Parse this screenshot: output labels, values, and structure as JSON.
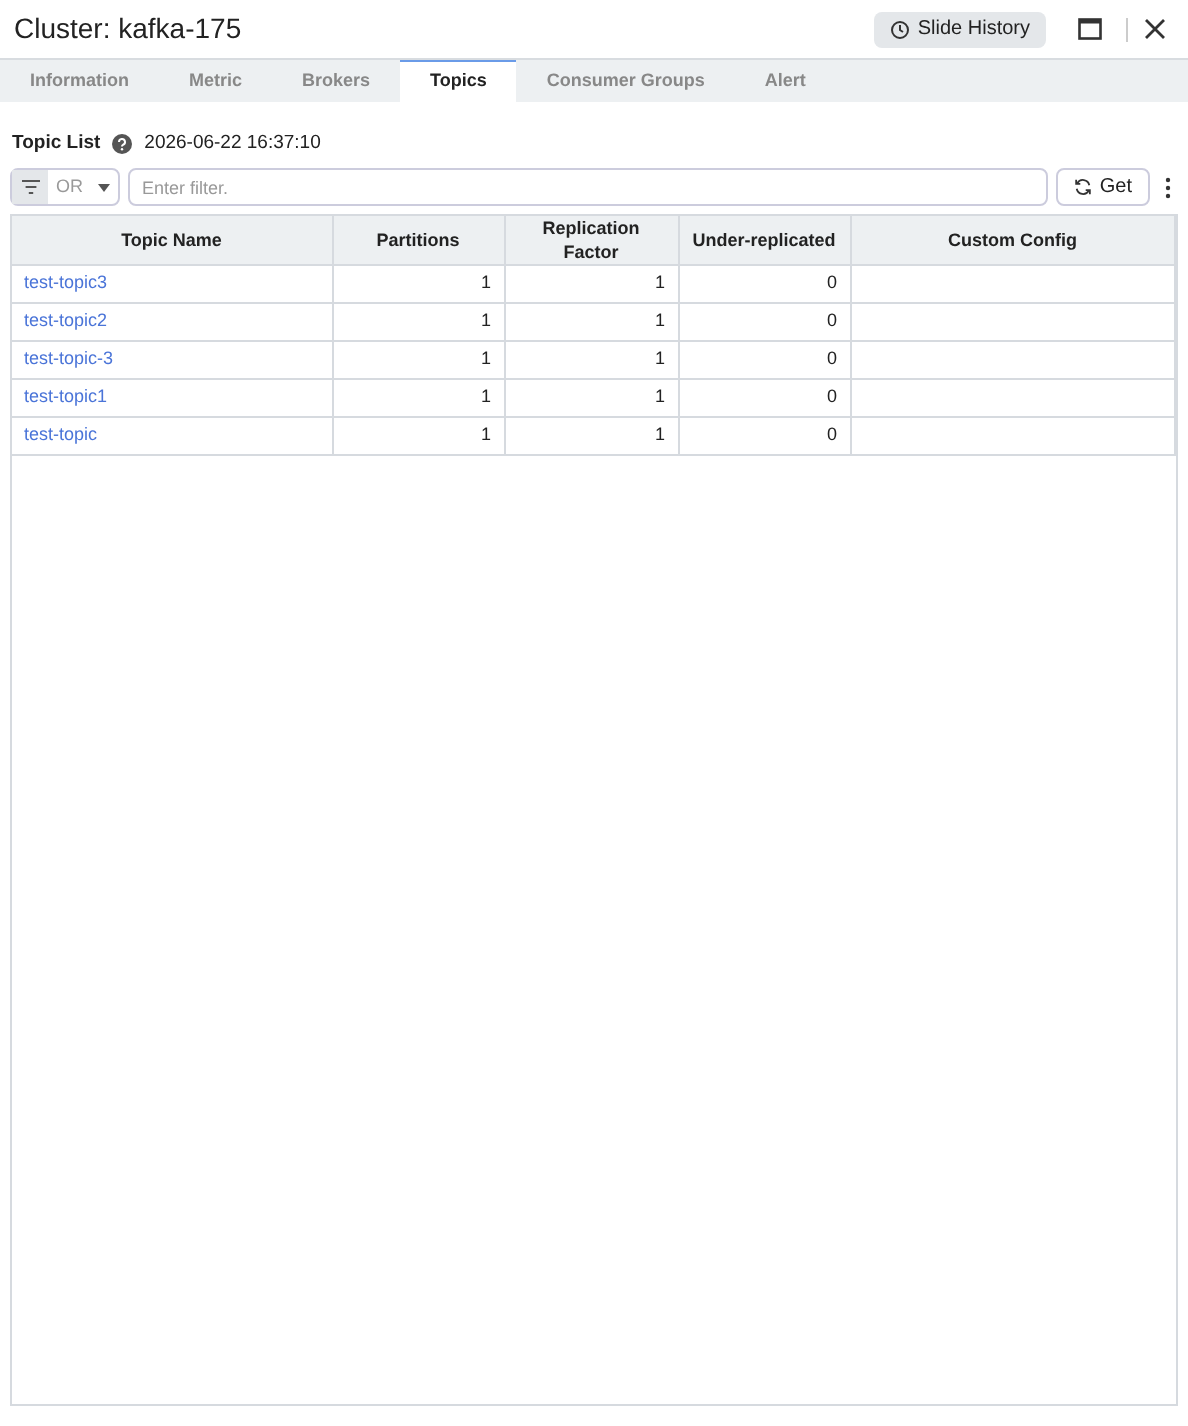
{
  "window": {
    "title": "Cluster: kafka-175",
    "history_button": "Slide History"
  },
  "tabs": [
    {
      "label": "Information",
      "selected": false
    },
    {
      "label": "Metric",
      "selected": false
    },
    {
      "label": "Brokers",
      "selected": false
    },
    {
      "label": "Topics",
      "selected": true
    },
    {
      "label": "Consumer Groups",
      "selected": false
    },
    {
      "label": "Alert",
      "selected": false
    }
  ],
  "section": {
    "title": "Topic List",
    "timestamp": "2026-06-22 16:37:10"
  },
  "filter": {
    "operator": "OR",
    "placeholder": "Enter filter.",
    "get_button": "Get"
  },
  "table": {
    "columns": [
      "Topic Name",
      "Partitions",
      "Replication Factor",
      "Under-replicated",
      "Custom Config"
    ],
    "rows": [
      {
        "name": "test-topic3",
        "partitions": "1",
        "replication": "1",
        "under": "0"
      },
      {
        "name": "test-topic2",
        "partitions": "1",
        "replication": "1",
        "under": "0"
      },
      {
        "name": "test-topic-3",
        "partitions": "1",
        "replication": "1",
        "under": "0"
      },
      {
        "name": "test-topic1",
        "partitions": "1",
        "replication": "1",
        "under": "0"
      },
      {
        "name": "test-topic",
        "partitions": "1",
        "replication": "1",
        "under": "0"
      }
    ]
  }
}
